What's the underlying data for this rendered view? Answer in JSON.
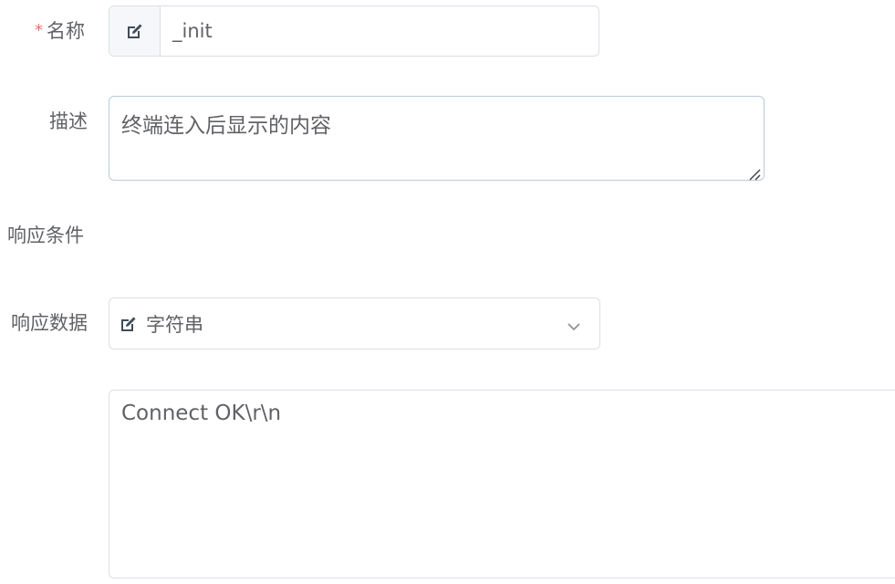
{
  "form": {
    "name": {
      "required_mark": "*",
      "label": "名称",
      "value": "_init",
      "prefix_icon": "edit-icon"
    },
    "description": {
      "label": "描述",
      "value": "终端连入后显示的内容"
    },
    "response_condition": {
      "label": "响应条件"
    },
    "response_data": {
      "label": "响应数据",
      "type_value": "字符串",
      "type_icon": "edit-icon",
      "content": "Connect OK\\r\\n"
    }
  },
  "colors": {
    "label": "#606266",
    "required": "#f56c6c",
    "border": "#dcdfe6",
    "focused_border": "#b3cde0",
    "prefix_bg": "#f5f7fa"
  }
}
